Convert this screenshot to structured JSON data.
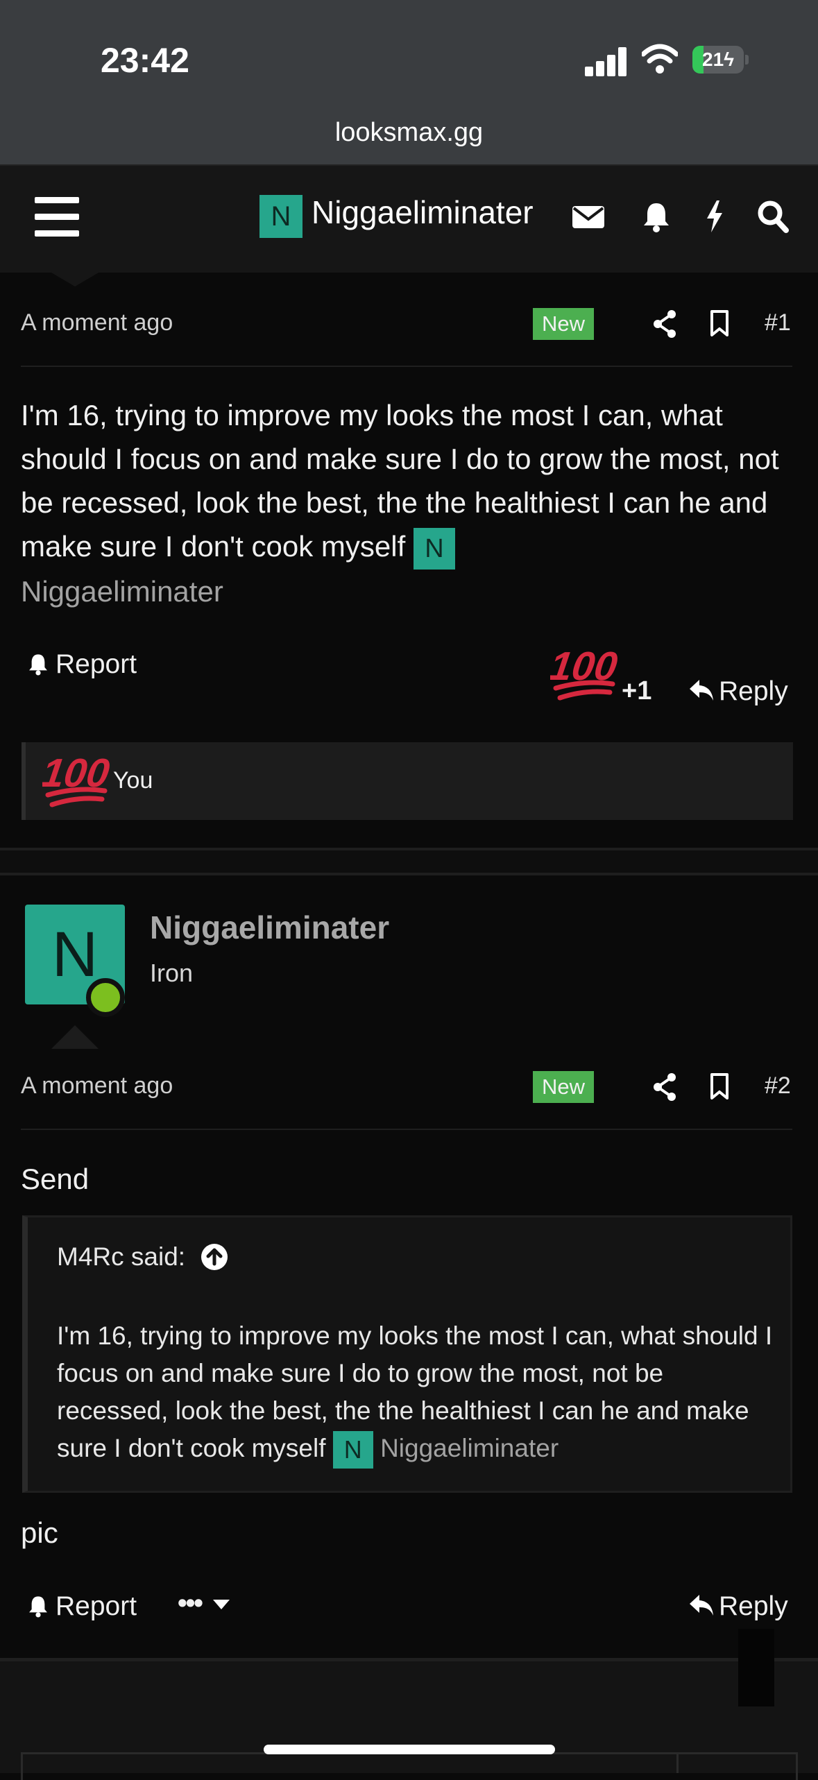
{
  "status_bar": {
    "time": "23:42",
    "battery": "21",
    "battery_level": 0.21
  },
  "browser": {
    "url": "looksmax.gg"
  },
  "header": {
    "avatar_letter": "N",
    "username": "Niggaeliminater",
    "icons": [
      "menu-icon",
      "mail-icon",
      "bell-icon",
      "bolt-icon",
      "search-icon"
    ]
  },
  "posts": [
    {
      "time": "A moment ago",
      "badge": "New",
      "number": "#1",
      "body": "I'm 16, trying to improve my looks the most I can, what should I focus on and make sure I do to grow the most, not be recessed, look the best, the the healthiest I can he and make sure I don't cook myself",
      "mention_letter": "N",
      "mention_name": "Niggaeliminater",
      "report_label": "Report",
      "reaction_emoji": "100",
      "reaction_count": "+1",
      "reply_label": "Reply",
      "reaction_list_user": "You"
    },
    {
      "author": "Niggaeliminater",
      "avatar_letter": "N",
      "rank": "Iron",
      "time": "A moment ago",
      "badge": "New",
      "number": "#2",
      "text_before": "Send",
      "quote_author": "M4Rc said:",
      "quote_body": "I'm 16, trying to improve my looks the most I can, what should I focus on and make sure I do to grow the most, not be recessed, look the best, the the healthiest I can he and make sure I don't cook myself",
      "quote_mention_letter": "N",
      "quote_mention_name": "Niggaeliminater",
      "text_after": "pic",
      "report_label": "Report",
      "more_label": "•••",
      "reply_label": "Reply"
    }
  ],
  "colors": {
    "accent_green": "#26a68c",
    "new_badge": "#4caf50",
    "online": "#7cbf1f",
    "emoji_red": "#d6283e"
  }
}
